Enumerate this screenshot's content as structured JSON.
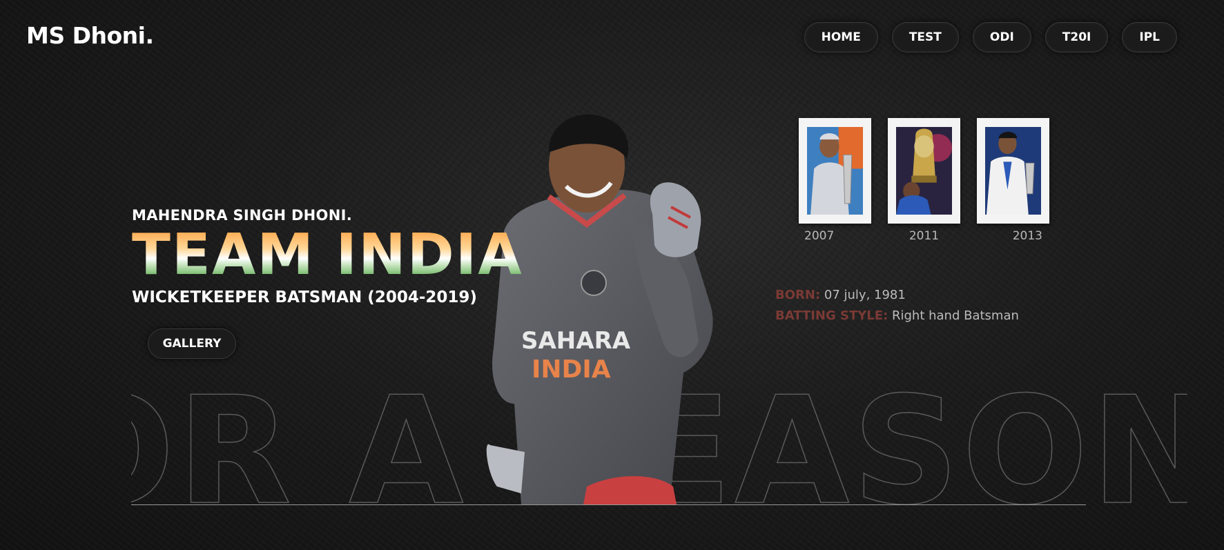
{
  "header": {
    "logo": "MS Dhoni.",
    "nav": [
      "HOME",
      "TEST",
      "ODI",
      "T20I",
      "IPL"
    ]
  },
  "hero": {
    "subtitle": "MAHENDRA SINGH DHONI.",
    "headline": "TEAM INDIA",
    "role": "WICKETKEEPER BATSMAN (2004-2019)",
    "gallery_label": "GALLERY",
    "background_outline_text": "OR A SEASON"
  },
  "trophies": [
    {
      "year": "2007",
      "image": "dhoni-t20-world-cup-trophy"
    },
    {
      "year": "2011",
      "image": "odi-world-cup-trophy"
    },
    {
      "year": "2013",
      "image": "dhoni-champions-trophy"
    }
  ],
  "bio": {
    "born_label": "BORN:",
    "born_value": "07 july, 1981",
    "batting_label": "BATTING STYLE:",
    "batting_value": "Right hand Batsman"
  },
  "colors": {
    "saffron": "#ff9933",
    "green": "#138808",
    "label_red": "#7b3a35",
    "background": "#1c1c1c"
  }
}
